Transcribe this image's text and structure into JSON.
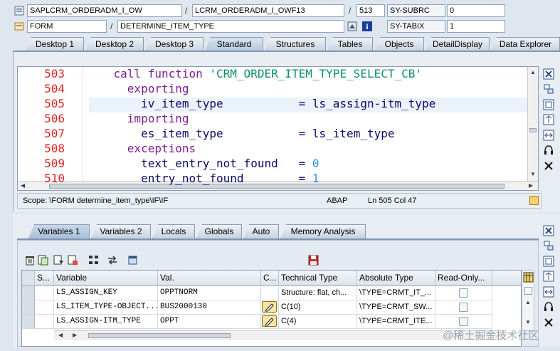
{
  "header": {
    "program": "SAPLCRM_ORDERADM_I_OW",
    "include": "LCRM_ORDERADM_I_OWF13",
    "line": "513",
    "sy1_name": "SY-SUBRC",
    "sy1_value": "0",
    "event_type": "FORM",
    "event_name": "DETERMINE_ITEM_TYPE",
    "sy2_name": "SY-TABIX",
    "sy2_value": "1",
    "slash": "/"
  },
  "tabs": [
    "Desktop 1",
    "Desktop 2",
    "Desktop 3",
    "Standard",
    "Structures",
    "Tables",
    "Objects",
    "DetailDisplay",
    "Data Explorer"
  ],
  "code": {
    "lines": [
      {
        "no": "503",
        "indent": "    ",
        "parts": [
          {
            "t": "call function ",
            "c": "kw"
          },
          {
            "t": "'CRM_ORDER_ITEM_TYPE_SELECT_CB'",
            "c": "str"
          }
        ]
      },
      {
        "no": "504",
        "indent": "      ",
        "parts": [
          {
            "t": "exporting",
            "c": "kw"
          }
        ]
      },
      {
        "no": "505",
        "indent": "        ",
        "parts": [
          {
            "t": "iv_item_type           ",
            "c": "id"
          },
          {
            "t": "= ",
            "c": "id"
          },
          {
            "t": "ls_assign-itm_type",
            "c": "id"
          }
        ]
      },
      {
        "no": "506",
        "indent": "      ",
        "parts": [
          {
            "t": "importing",
            "c": "kw"
          }
        ]
      },
      {
        "no": "507",
        "indent": "        ",
        "parts": [
          {
            "t": "es_item_type           ",
            "c": "id"
          },
          {
            "t": "= ",
            "c": "id"
          },
          {
            "t": "ls_item_type",
            "c": "id"
          }
        ]
      },
      {
        "no": "508",
        "indent": "      ",
        "parts": [
          {
            "t": "exceptions",
            "c": "kw"
          }
        ]
      },
      {
        "no": "509",
        "indent": "        ",
        "parts": [
          {
            "t": "text_entry_not_found   ",
            "c": "id"
          },
          {
            "t": "= ",
            "c": "id"
          },
          {
            "t": "0",
            "c": "num"
          }
        ]
      },
      {
        "no": "510",
        "indent": "        ",
        "parts": [
          {
            "t": "entry_not_found        ",
            "c": "id"
          },
          {
            "t": "= ",
            "c": "id"
          },
          {
            "t": "1",
            "c": "num"
          }
        ]
      }
    ]
  },
  "status": {
    "scope": "Scope: \\FORM determine_item_type\\IF\\IF",
    "language": "ABAP",
    "position": "Ln 505 Col  47"
  },
  "bottom_tabs": [
    "Variables 1",
    "Variables 2",
    "Locals",
    "Globals",
    "Auto",
    "Memory Analysis"
  ],
  "grid": {
    "headers": [
      "S...",
      "Variable",
      "Val.",
      "C...",
      "Technical Type",
      "Absolute Type",
      "Read-Only..."
    ],
    "rows": [
      {
        "variable": "LS_ASSIGN_KEY",
        "value": "OPPTNORM",
        "change": false,
        "tech": "Structure: flat, ch...",
        "abs": "\\TYPE=CRMT_IT_..."
      },
      {
        "variable": "LS_ITEM_TYPE-OBJECT...",
        "value": "BUS2000130",
        "change": true,
        "tech": "C(10)",
        "abs": "\\TYPE=CRMT_SW..."
      },
      {
        "variable": "LS_ASSIGN-ITM_TYPE",
        "value": "OPPT",
        "change": true,
        "tech": "C(4)",
        "abs": "\\TYPE=CRMT_ITE..."
      }
    ]
  },
  "watermark": "@稀土掘金技术社区",
  "colors": {
    "keyword": "#7d1f8f",
    "string": "#0a8f6a",
    "number": "#2a8ff0",
    "lineno": "#d22222"
  }
}
